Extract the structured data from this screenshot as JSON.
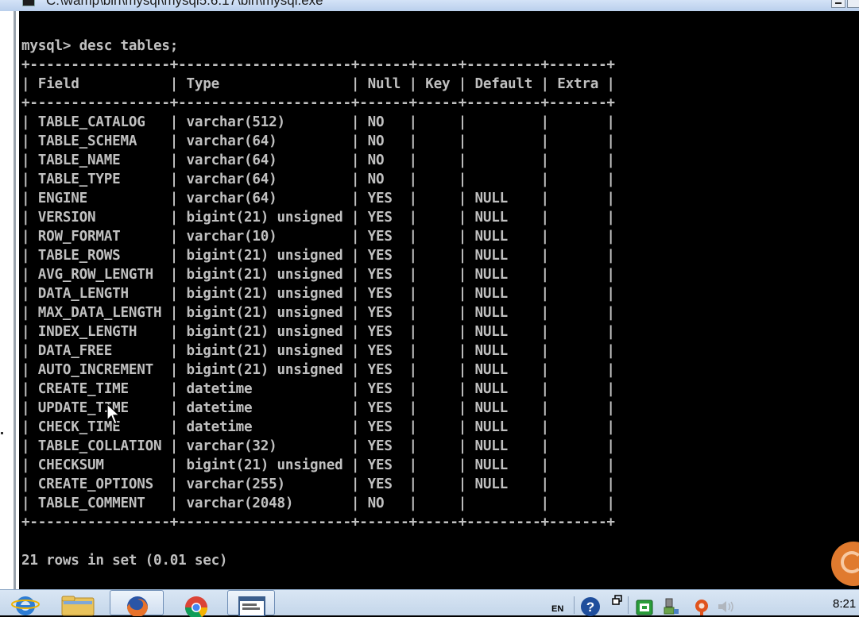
{
  "window": {
    "title": "C:\\wamp\\bin\\mysql\\mysql5.6.17\\bin\\mysql.exe"
  },
  "console": {
    "command": "mysql> desc tables;",
    "separator": "+-----------------+---------------------+------+-----+---------+-------+",
    "columns": [
      "Field",
      "Type",
      "Null",
      "Key",
      "Default",
      "Extra"
    ],
    "column_widths": [
      15,
      19,
      4,
      3,
      7,
      5
    ],
    "rows": [
      [
        "TABLE_CATALOG",
        "varchar(512)",
        "NO",
        "",
        "",
        ""
      ],
      [
        "TABLE_SCHEMA",
        "varchar(64)",
        "NO",
        "",
        "",
        ""
      ],
      [
        "TABLE_NAME",
        "varchar(64)",
        "NO",
        "",
        "",
        ""
      ],
      [
        "TABLE_TYPE",
        "varchar(64)",
        "NO",
        "",
        "",
        ""
      ],
      [
        "ENGINE",
        "varchar(64)",
        "YES",
        "",
        "NULL",
        ""
      ],
      [
        "VERSION",
        "bigint(21) unsigned",
        "YES",
        "",
        "NULL",
        ""
      ],
      [
        "ROW_FORMAT",
        "varchar(10)",
        "YES",
        "",
        "NULL",
        ""
      ],
      [
        "TABLE_ROWS",
        "bigint(21) unsigned",
        "YES",
        "",
        "NULL",
        ""
      ],
      [
        "AVG_ROW_LENGTH",
        "bigint(21) unsigned",
        "YES",
        "",
        "NULL",
        ""
      ],
      [
        "DATA_LENGTH",
        "bigint(21) unsigned",
        "YES",
        "",
        "NULL",
        ""
      ],
      [
        "MAX_DATA_LENGTH",
        "bigint(21) unsigned",
        "YES",
        "",
        "NULL",
        ""
      ],
      [
        "INDEX_LENGTH",
        "bigint(21) unsigned",
        "YES",
        "",
        "NULL",
        ""
      ],
      [
        "DATA_FREE",
        "bigint(21) unsigned",
        "YES",
        "",
        "NULL",
        ""
      ],
      [
        "AUTO_INCREMENT",
        "bigint(21) unsigned",
        "YES",
        "",
        "NULL",
        ""
      ],
      [
        "CREATE_TIME",
        "datetime",
        "YES",
        "",
        "NULL",
        ""
      ],
      [
        "UPDATE_TIME",
        "datetime",
        "YES",
        "",
        "NULL",
        ""
      ],
      [
        "CHECK_TIME",
        "datetime",
        "YES",
        "",
        "NULL",
        ""
      ],
      [
        "TABLE_COLLATION",
        "varchar(32)",
        "YES",
        "",
        "NULL",
        ""
      ],
      [
        "CHECKSUM",
        "bigint(21) unsigned",
        "YES",
        "",
        "NULL",
        ""
      ],
      [
        "CREATE_OPTIONS",
        "varchar(255)",
        "YES",
        "",
        "NULL",
        ""
      ],
      [
        "TABLE_COMMENT",
        "varchar(2048)",
        "NO",
        "",
        "",
        ""
      ]
    ],
    "summary": "21 rows in set (0.01 sec)",
    "prompt": "mysql> "
  },
  "taskbar": {
    "apps": [
      {
        "name": "internet-explorer-icon"
      },
      {
        "name": "file-explorer-icon"
      },
      {
        "name": "firefox-icon"
      },
      {
        "name": "chrome-icon"
      },
      {
        "name": "console-window-icon"
      }
    ],
    "tray": {
      "language": "EN",
      "time": "8:21"
    }
  },
  "colors": {
    "console_bg": "#000000",
    "console_text": "#c0c0c0",
    "taskbar_bg": "#d0dff0",
    "accent_orange": "#e07a2e"
  }
}
